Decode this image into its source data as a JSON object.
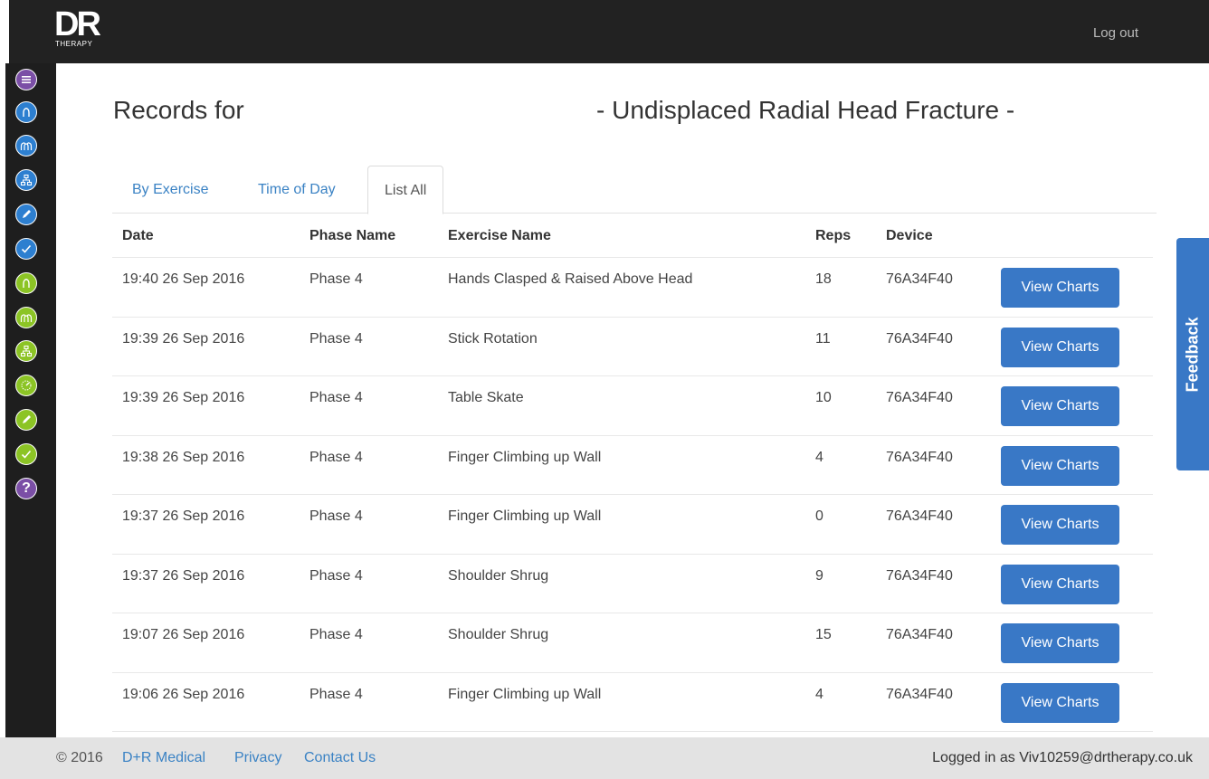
{
  "header": {
    "logo_main": "DR",
    "logo_sub": "THERAPY",
    "logout_label": "Log out"
  },
  "sidebar": {
    "items": [
      {
        "icon": "menu-icon",
        "color": "#7b4fa6"
      },
      {
        "icon": "person-icon",
        "color": "#2d7fd0"
      },
      {
        "icon": "people-icon",
        "color": "#2d7fd0"
      },
      {
        "icon": "hierarchy-icon",
        "color": "#2d7fd0"
      },
      {
        "icon": "pencil-icon",
        "color": "#2d7fd0"
      },
      {
        "icon": "check-icon",
        "color": "#2d7fd0"
      },
      {
        "icon": "person-icon",
        "color": "#8cc425"
      },
      {
        "icon": "people-icon",
        "color": "#8cc425"
      },
      {
        "icon": "hierarchy-icon",
        "color": "#8cc425"
      },
      {
        "icon": "gauge-icon",
        "color": "#8cc425"
      },
      {
        "icon": "pencil-icon",
        "color": "#8cc425"
      },
      {
        "icon": "check-icon",
        "color": "#8cc425"
      },
      {
        "icon": "help-icon",
        "color": "#7b4fa6",
        "glyph": "?"
      }
    ]
  },
  "main": {
    "records_label": "Records for",
    "condition_title": "- Undisplaced Radial Head Fracture -",
    "tabs": [
      {
        "label": "By Exercise"
      },
      {
        "label": "Time of Day"
      },
      {
        "label": "List All"
      }
    ],
    "table": {
      "headers": [
        "Date",
        "Phase Name",
        "Exercise Name",
        "Reps",
        "Device"
      ],
      "button_label": "View Charts",
      "rows": [
        {
          "date": "19:40 26 Sep 2016",
          "phase": "Phase 4",
          "exercise": "Hands Clasped & Raised Above Head",
          "reps": "18",
          "device": "76A34F40"
        },
        {
          "date": "19:39 26 Sep 2016",
          "phase": "Phase 4",
          "exercise": "Stick Rotation",
          "reps": "11",
          "device": "76A34F40"
        },
        {
          "date": "19:39 26 Sep 2016",
          "phase": "Phase 4",
          "exercise": "Table Skate",
          "reps": "10",
          "device": "76A34F40"
        },
        {
          "date": "19:38 26 Sep 2016",
          "phase": "Phase 4",
          "exercise": "Finger Climbing up Wall",
          "reps": "4",
          "device": "76A34F40"
        },
        {
          "date": "19:37 26 Sep 2016",
          "phase": "Phase 4",
          "exercise": "Finger Climbing up Wall",
          "reps": "0",
          "device": "76A34F40"
        },
        {
          "date": "19:37 26 Sep 2016",
          "phase": "Phase 4",
          "exercise": "Shoulder Shrug",
          "reps": "9",
          "device": "76A34F40"
        },
        {
          "date": "19:07 26 Sep 2016",
          "phase": "Phase 4",
          "exercise": "Shoulder Shrug",
          "reps": "15",
          "device": "76A34F40"
        },
        {
          "date": "19:06 26 Sep 2016",
          "phase": "Phase 4",
          "exercise": "Finger Climbing up Wall",
          "reps": "4",
          "device": "76A34F40"
        }
      ]
    }
  },
  "feedback_label": "Feedback",
  "footer": {
    "copyright": "© 2016",
    "links": [
      "D+R Medical",
      "Privacy",
      "Contact Us"
    ],
    "logged_in": "Logged in as Viv10259@drtherapy.co.uk"
  },
  "colors": {
    "accent": "#3978c6",
    "link": "#3a82c4",
    "sidebar_purple": "#7b4fa6",
    "sidebar_blue": "#2d7fd0",
    "sidebar_green": "#8cc425",
    "topbar": "#222222"
  }
}
